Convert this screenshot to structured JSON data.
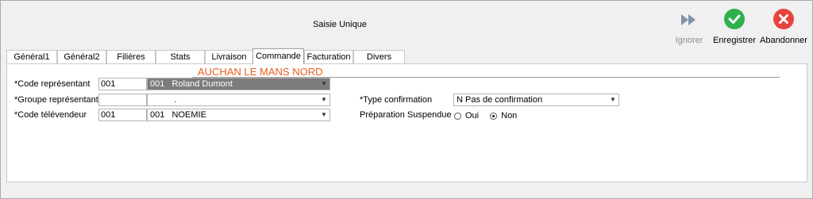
{
  "window": {
    "title": "Saisie Unique"
  },
  "toolbar": {
    "ignore_label": "Ignorer",
    "save_label": "Enregistrer",
    "cancel_label": "Abandonner"
  },
  "tabs": [
    {
      "label": "Général1",
      "active": false
    },
    {
      "label": "Général2",
      "active": false
    },
    {
      "label": "Filières",
      "active": false
    },
    {
      "label": "Stats",
      "active": false
    },
    {
      "label": "Livraison",
      "active": false
    },
    {
      "label": "Commande",
      "active": true
    },
    {
      "label": "Facturation",
      "active": false
    },
    {
      "label": "Divers",
      "active": false
    }
  ],
  "form": {
    "client_name": "AUCHAN LE MANS NORD",
    "code_representant": {
      "label": "*Code représentant",
      "code": "001",
      "combo": "001   Roland Dumont"
    },
    "groupe_representant": {
      "label": "*Groupe représentant",
      "code": "",
      "combo": "          ."
    },
    "code_televendeur": {
      "label": "*Code télévendeur",
      "code": "001",
      "combo": "001   NOEMIE"
    },
    "type_confirmation": {
      "label": "*Type confirmation",
      "combo": "N Pas de confirmation"
    },
    "preparation_suspendue": {
      "label": "Préparation Suspendue",
      "options": [
        {
          "label": "Oui",
          "checked": false
        },
        {
          "label": "Non",
          "checked": true
        }
      ]
    }
  },
  "colors": {
    "client_name": "#e85c1e",
    "save_icon": "#2fb04c",
    "cancel_icon": "#e8433f",
    "ignore_icon": "#7f93a8",
    "selected_combo": "#7c7c7c"
  }
}
